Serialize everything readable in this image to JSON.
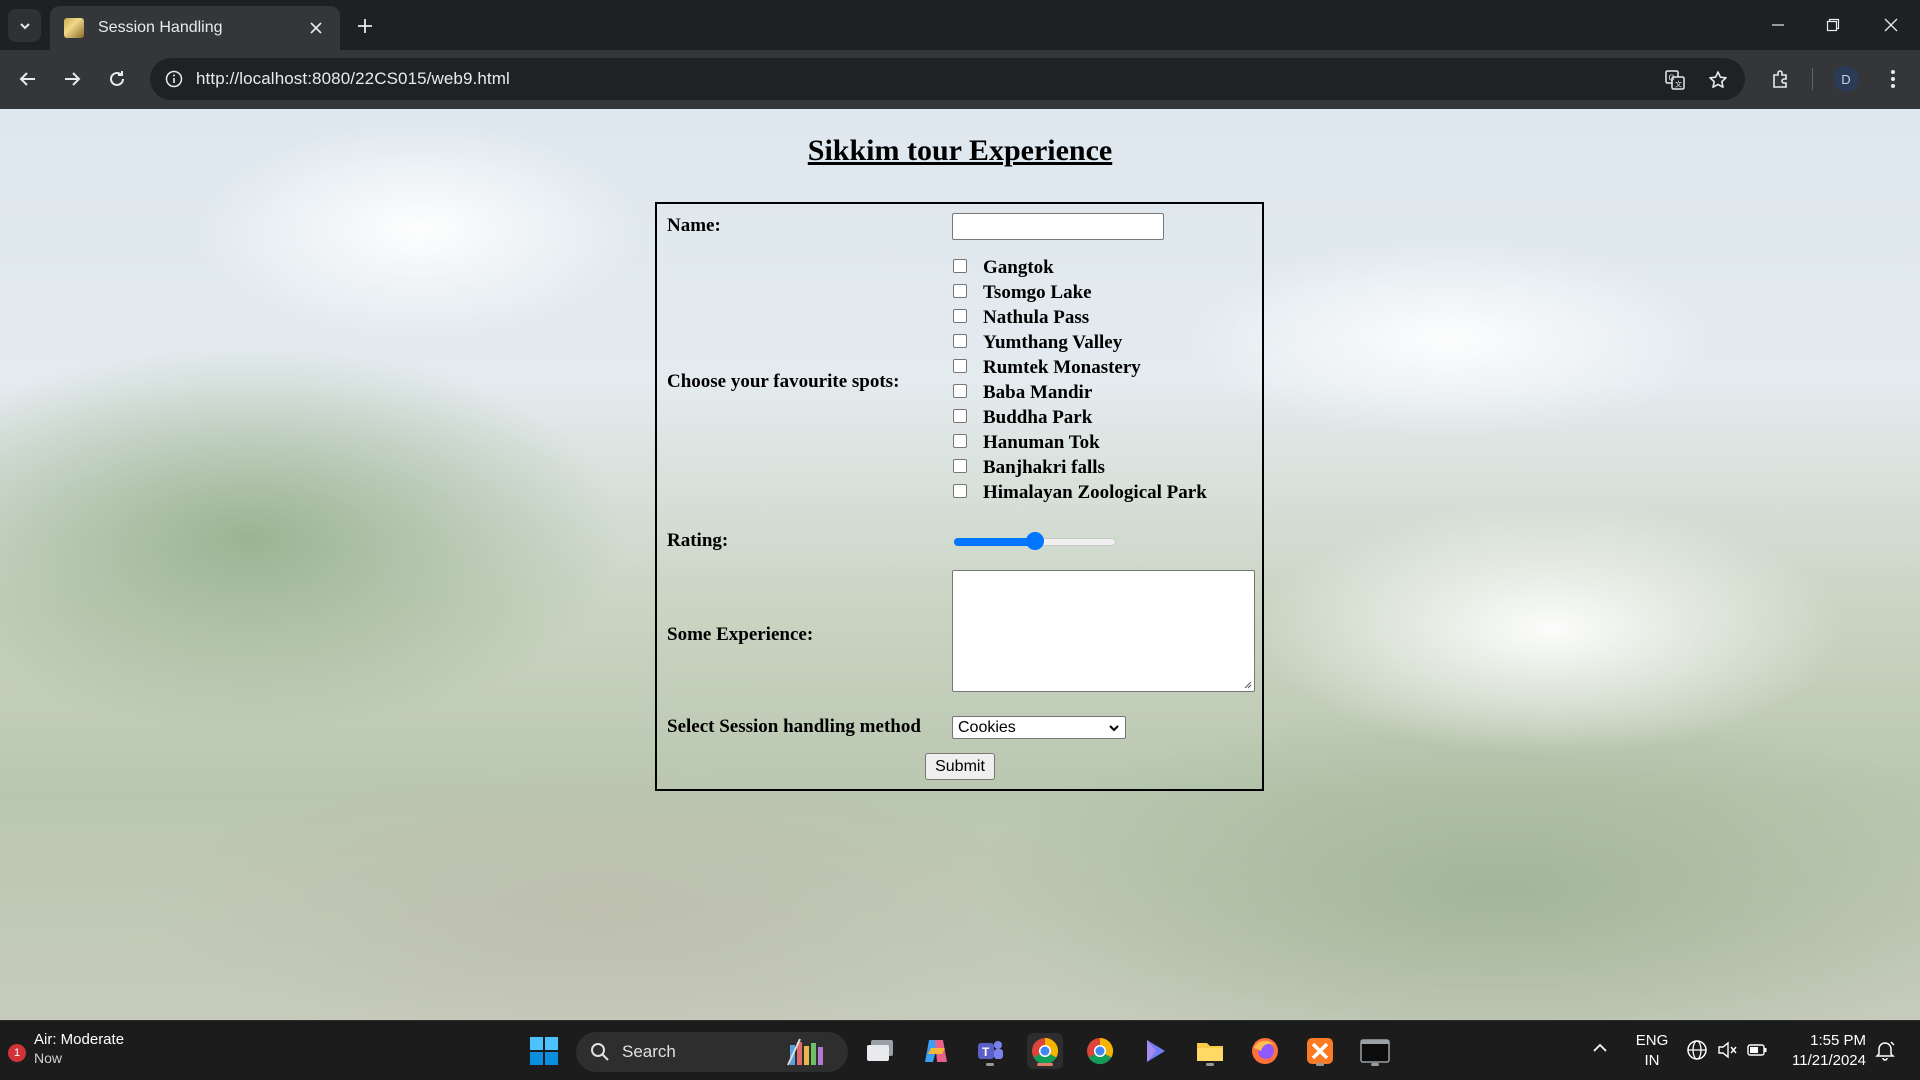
{
  "browser": {
    "tab_title": "Session Handling",
    "url": "http://localhost:8080/22CS015/web9.html",
    "profile_initial": "D"
  },
  "page": {
    "heading": "Sikkim tour Experience",
    "form": {
      "name_label": "Name:",
      "name_value": "",
      "spots_label": "Choose your favourite spots:",
      "spots": [
        {
          "label": "Gangtok",
          "checked": false
        },
        {
          "label": "Tsomgo Lake",
          "checked": false
        },
        {
          "label": "Nathula Pass",
          "checked": false
        },
        {
          "label": "Yumthang Valley",
          "checked": false
        },
        {
          "label": "Rumtek Monastery",
          "checked": false
        },
        {
          "label": "Baba Mandir",
          "checked": false
        },
        {
          "label": "Buddha Park",
          "checked": false
        },
        {
          "label": "Hanuman Tok",
          "checked": false
        },
        {
          "label": "Banjhakri falls",
          "checked": false
        },
        {
          "label": "Himalayan Zoological Park",
          "checked": false
        }
      ],
      "rating_label": "Rating:",
      "rating_fraction": 0.5,
      "experience_label": "Some Experience:",
      "experience_value": "",
      "session_label": "Select Session handling method",
      "session_selected": "Cookies",
      "submit_label": "Submit"
    }
  },
  "taskbar": {
    "weather_title": "Air: Moderate",
    "weather_sub": "Now",
    "weather_badge": "1",
    "search_label": "Search",
    "lang_top": "ENG",
    "lang_bottom": "IN",
    "time": "1:55 PM",
    "date": "11/21/2024"
  },
  "colors": {
    "accent": "#0075ff",
    "chrome_dark": "#1f2023",
    "toolbar": "#35363a"
  }
}
